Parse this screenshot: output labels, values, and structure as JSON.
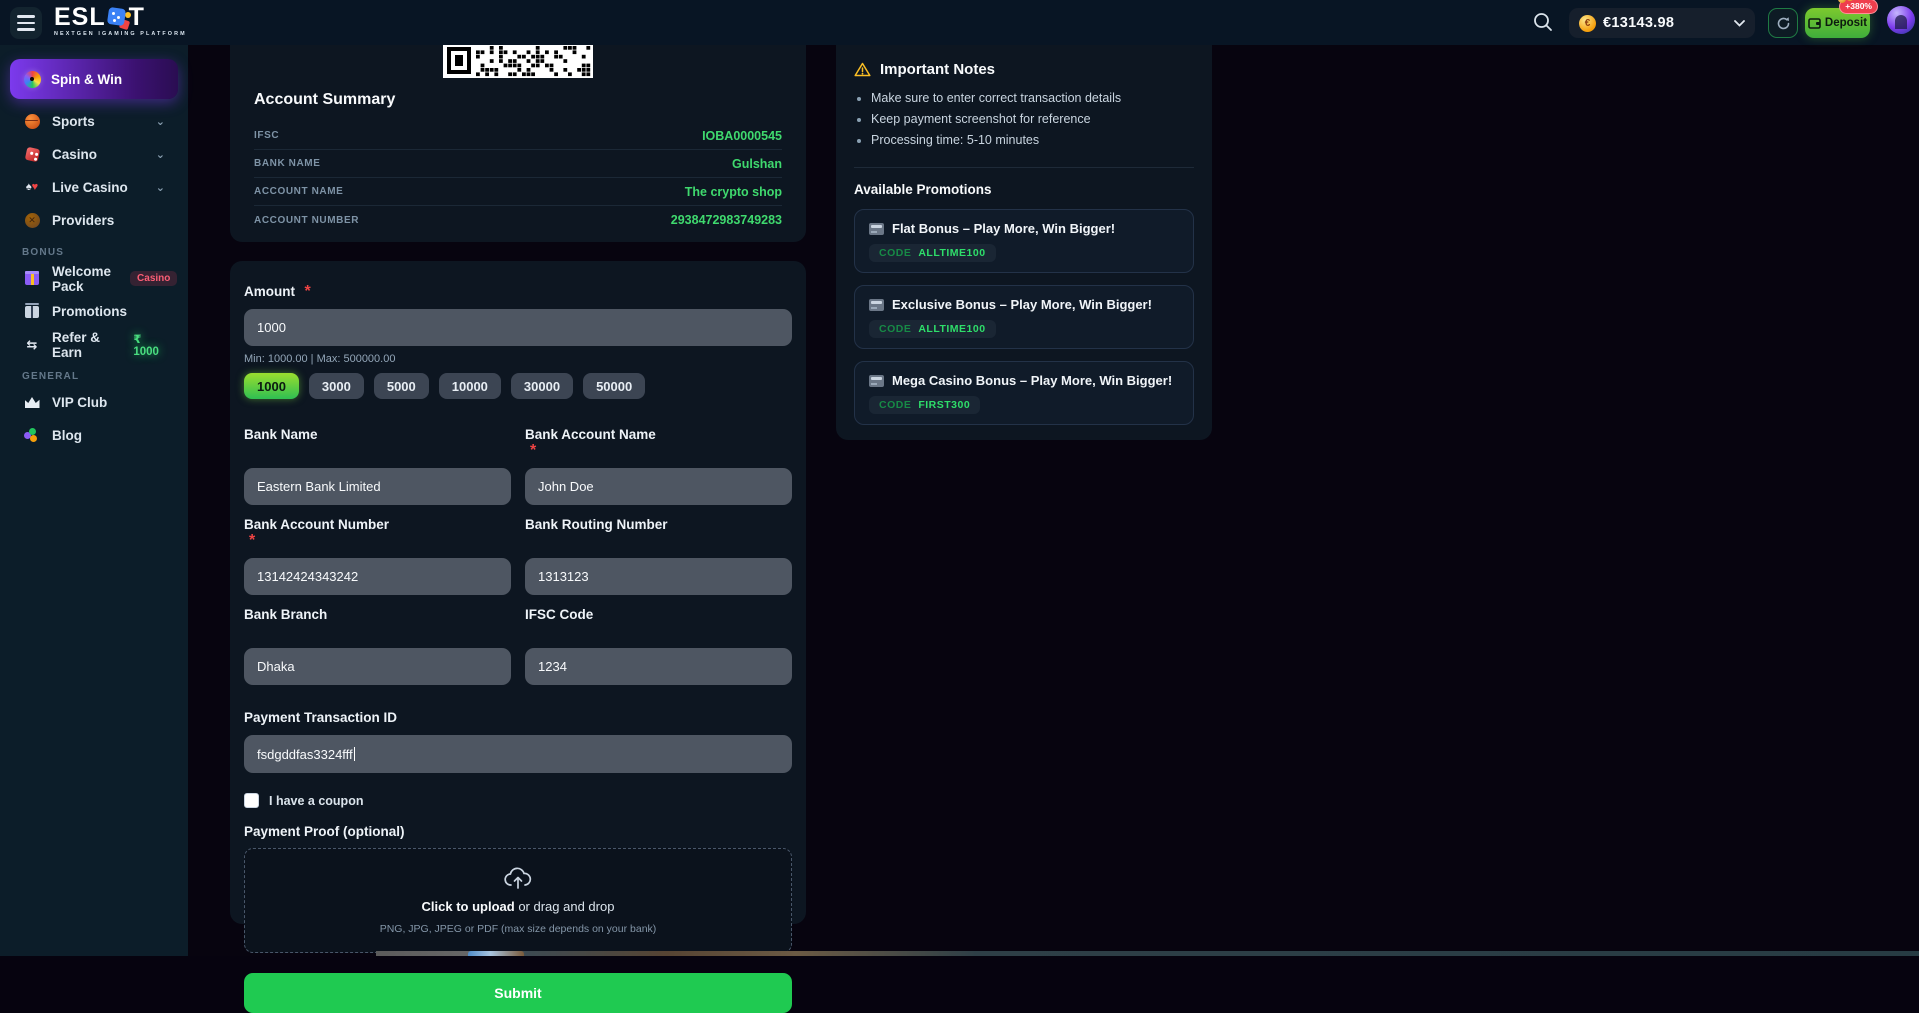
{
  "topbar": {
    "logo": {
      "prefix": "ESL",
      "suffix": "T",
      "tagline": "NEXTGEN IGAMING PLATFORM"
    },
    "balance": {
      "amount": "€13143.98"
    },
    "deposit": {
      "label": "Deposit",
      "badge": "+380%"
    }
  },
  "sidebar": {
    "items": [
      {
        "label": "Spin & Win"
      },
      {
        "label": "Sports"
      },
      {
        "label": "Casino"
      },
      {
        "label": "Live Casino"
      },
      {
        "label": "Providers"
      }
    ],
    "bonus_header": "BONUS",
    "bonus_items": [
      {
        "label": "Welcome Pack",
        "badge": "Casino"
      },
      {
        "label": "Promotions"
      },
      {
        "label": "Refer & Earn",
        "badge": "₹ 1000"
      }
    ],
    "general_header": "GENERAL",
    "general_items": [
      {
        "label": "VIP Club"
      },
      {
        "label": "Blog"
      }
    ]
  },
  "account_summary": {
    "title": "Account Summary",
    "rows": [
      {
        "label": "IFSC",
        "value": "IOBA0000545"
      },
      {
        "label": "BANK NAME",
        "value": "Gulshan"
      },
      {
        "label": "ACCOUNT NAME",
        "value": "The crypto shop"
      },
      {
        "label": "ACCOUNT NUMBER",
        "value": "2938472983749283"
      }
    ]
  },
  "deposit_form": {
    "amount": {
      "label": "Amount",
      "required": "*",
      "value": "1000",
      "hint": "Min: 1000.00 | Max: 500000.00",
      "quick_options": [
        "1000",
        "3000",
        "5000",
        "10000",
        "30000",
        "50000"
      ],
      "selected": "1000"
    },
    "fields": [
      {
        "label": "Bank Name",
        "value": "Eastern Bank Limited"
      },
      {
        "label": "Bank Account Name",
        "required": "*",
        "value": "John Doe"
      },
      {
        "label": "Bank Account Number",
        "required": "*",
        "value": "13142424343242"
      },
      {
        "label": "Bank Routing Number",
        "value": "1313123"
      },
      {
        "label": "Bank Branch",
        "value": "Dhaka"
      },
      {
        "label": "IFSC Code",
        "value": "1234"
      }
    ],
    "transaction_id": {
      "label": "Payment Transaction ID",
      "value": "fsdgddfas3324fff"
    },
    "coupon_label": "I have a coupon",
    "proof": {
      "label": "Payment Proof (optional)",
      "cta": "Click to upload",
      "cta_rest": " or drag and drop",
      "hint": "PNG, JPG, JPEG or PDF (max size depends on your bank)"
    },
    "submit_label": "Submit"
  },
  "notes": {
    "title": "Important Notes",
    "items": [
      "Make sure to enter correct transaction details",
      "Keep payment screenshot for reference",
      "Processing time: 5-10 minutes"
    ]
  },
  "promotions": {
    "title": "Available Promotions",
    "code_label": "CODE",
    "cards": [
      {
        "title": "Flat Bonus – Play More, Win Bigger!",
        "code": "ALLTIME100"
      },
      {
        "title": "Exclusive Bonus – Play More, Win Bigger!",
        "code": "ALLTIME100"
      },
      {
        "title": "Mega Casino Bonus – Play More, Win Bigger!",
        "code": "FIRST300"
      }
    ]
  },
  "colors": {
    "accent_green": "#22c55e",
    "value_green": "#4ade80",
    "active_purple": "#7c3aed",
    "warning_yellow": "#fbbf24",
    "required_red": "#ef4444",
    "badge_red": "#f43f5e"
  }
}
